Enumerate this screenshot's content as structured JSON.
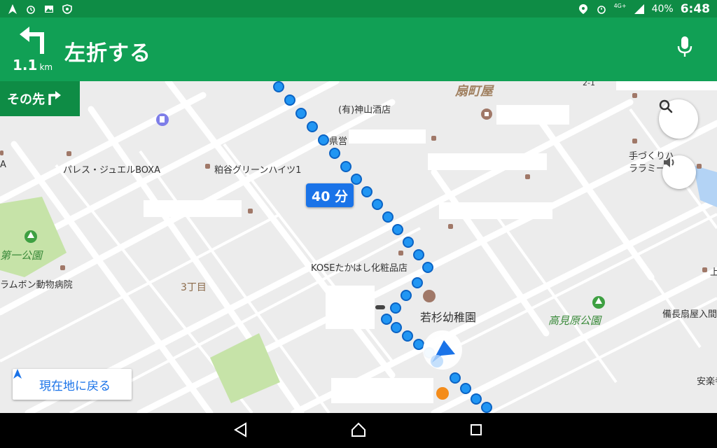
{
  "status_bar": {
    "left_icons": [
      "navigation-icon",
      "alarm-icon",
      "image-icon",
      "shield-icon"
    ],
    "network": "4G+",
    "battery": "40%",
    "time": "6:48"
  },
  "navigation": {
    "distance_value": "1.1",
    "distance_unit": "km",
    "instruction": "左折する",
    "then_label": "その先"
  },
  "route": {
    "eta": "40 分"
  },
  "map_labels": {
    "shop_1": "(有)神山酒店",
    "shop_2": "県営",
    "palace": "パレス・ジュエルBOXA",
    "palace_prefix": "A",
    "heights": "粕谷グリーンハイツ1",
    "park_1": "第一公園",
    "vet": "ラムボン動物病院",
    "district": "3丁目",
    "cosmetics": "KOSEたかはし化粧品店",
    "kindergarten": "若杉幼稚園",
    "park_2": "高見原公園",
    "ougiya": "扇町屋",
    "handmade": "手づくりハ",
    "laramie": "ララミー",
    "bincho": "備長扇屋入間",
    "anraku": "安楽寺",
    "kami": "上",
    "block": "2-1"
  },
  "buttons": {
    "recenter": "現在地に戻る"
  },
  "colors": {
    "header_green": "#11a055",
    "status_green": "#0e8c45",
    "route_blue": "#1a73e8",
    "route_dot": "#2196f3"
  }
}
